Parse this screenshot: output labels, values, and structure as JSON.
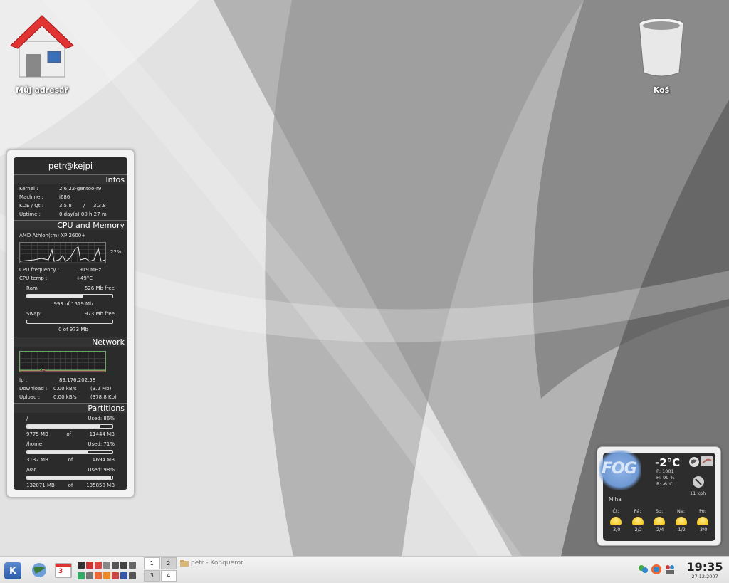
{
  "desktop": {
    "home_label": "Můj adresář",
    "trash_label": "Koš"
  },
  "sysinfo": {
    "hostname": "petr@kejpi",
    "infos": {
      "title": "Infos",
      "kernel_k": "Kernel :",
      "kernel_v": "2.6.22-gentoo-r9",
      "machine_k": "Machine :",
      "machine_v": "i686",
      "kde_k": "KDE / Qt :",
      "kde_v": "3.5.8",
      "sep": "/",
      "qt_v": "3.3.8",
      "uptime_k": "Uptime :",
      "uptime_v": "0 day(s)  00 h 27 m"
    },
    "cpu": {
      "title": "CPU and Memory",
      "model": "AMD Athlon(tm) XP 2600+",
      "load": "22%",
      "freq_k": "CPU frequency :",
      "freq_v": "1919 MHz",
      "temp_k": "CPU temp :",
      "temp_v": "+49°C",
      "ram_k": "Ram",
      "ram_free": "526 Mb free",
      "ram_used": "993 of 1519 Mb",
      "ram_fraction": 0.65,
      "swap_k": "Swap:",
      "swap_free": "973 Mb free",
      "swap_used": "0 of 973 Mb",
      "swap_fraction": 0.0
    },
    "network": {
      "title": "Network",
      "ip_k": "Ip :",
      "ip_v": "89.176.202.58",
      "down_k": "Download :",
      "down_v": "0.00 kB/s",
      "down_tot": "(3.2 Mb)",
      "up_k": "Upload :",
      "up_v": "0.00 kB/s",
      "up_tot": "(378.8 Kb)"
    },
    "partitions": {
      "title": "Partitions",
      "of": "of",
      "items": [
        {
          "name": "/",
          "used": "Used: 86%",
          "a": "9775 MB",
          "b": "11444 MB",
          "fraction": 0.86
        },
        {
          "name": "/home",
          "used": "Used: 71%",
          "a": "3132 MB",
          "b": "4694 MB",
          "fraction": 0.71
        },
        {
          "name": "/var",
          "used": "Used: 98%",
          "a": "132071 MB",
          "b": "135858 MB",
          "fraction": 0.98
        }
      ]
    }
  },
  "weather": {
    "fog": "FOG",
    "temp": "-2°C",
    "p": "P:   1001",
    "h": "H:   99 %",
    "r": "R:   -6°C",
    "wind": "11 kph",
    "desc": "Mlha",
    "days": [
      {
        "d": "Čt:",
        "t": "-3/0"
      },
      {
        "d": "Pá:",
        "t": "-2/2"
      },
      {
        "d": "So:",
        "t": "-2/4"
      },
      {
        "d": "Ne:",
        "t": "-1/2"
      },
      {
        "d": "Po:",
        "t": "-3/0"
      }
    ]
  },
  "taskbar": {
    "pager": [
      "1",
      "2",
      "3",
      "4"
    ],
    "task": "petr - Konqueror",
    "time": "19:35",
    "date": "27.12.2007",
    "calendar_day": "3"
  },
  "colors": {
    "accent": "#2c5aa8",
    "panel": "#2b2b2b"
  }
}
